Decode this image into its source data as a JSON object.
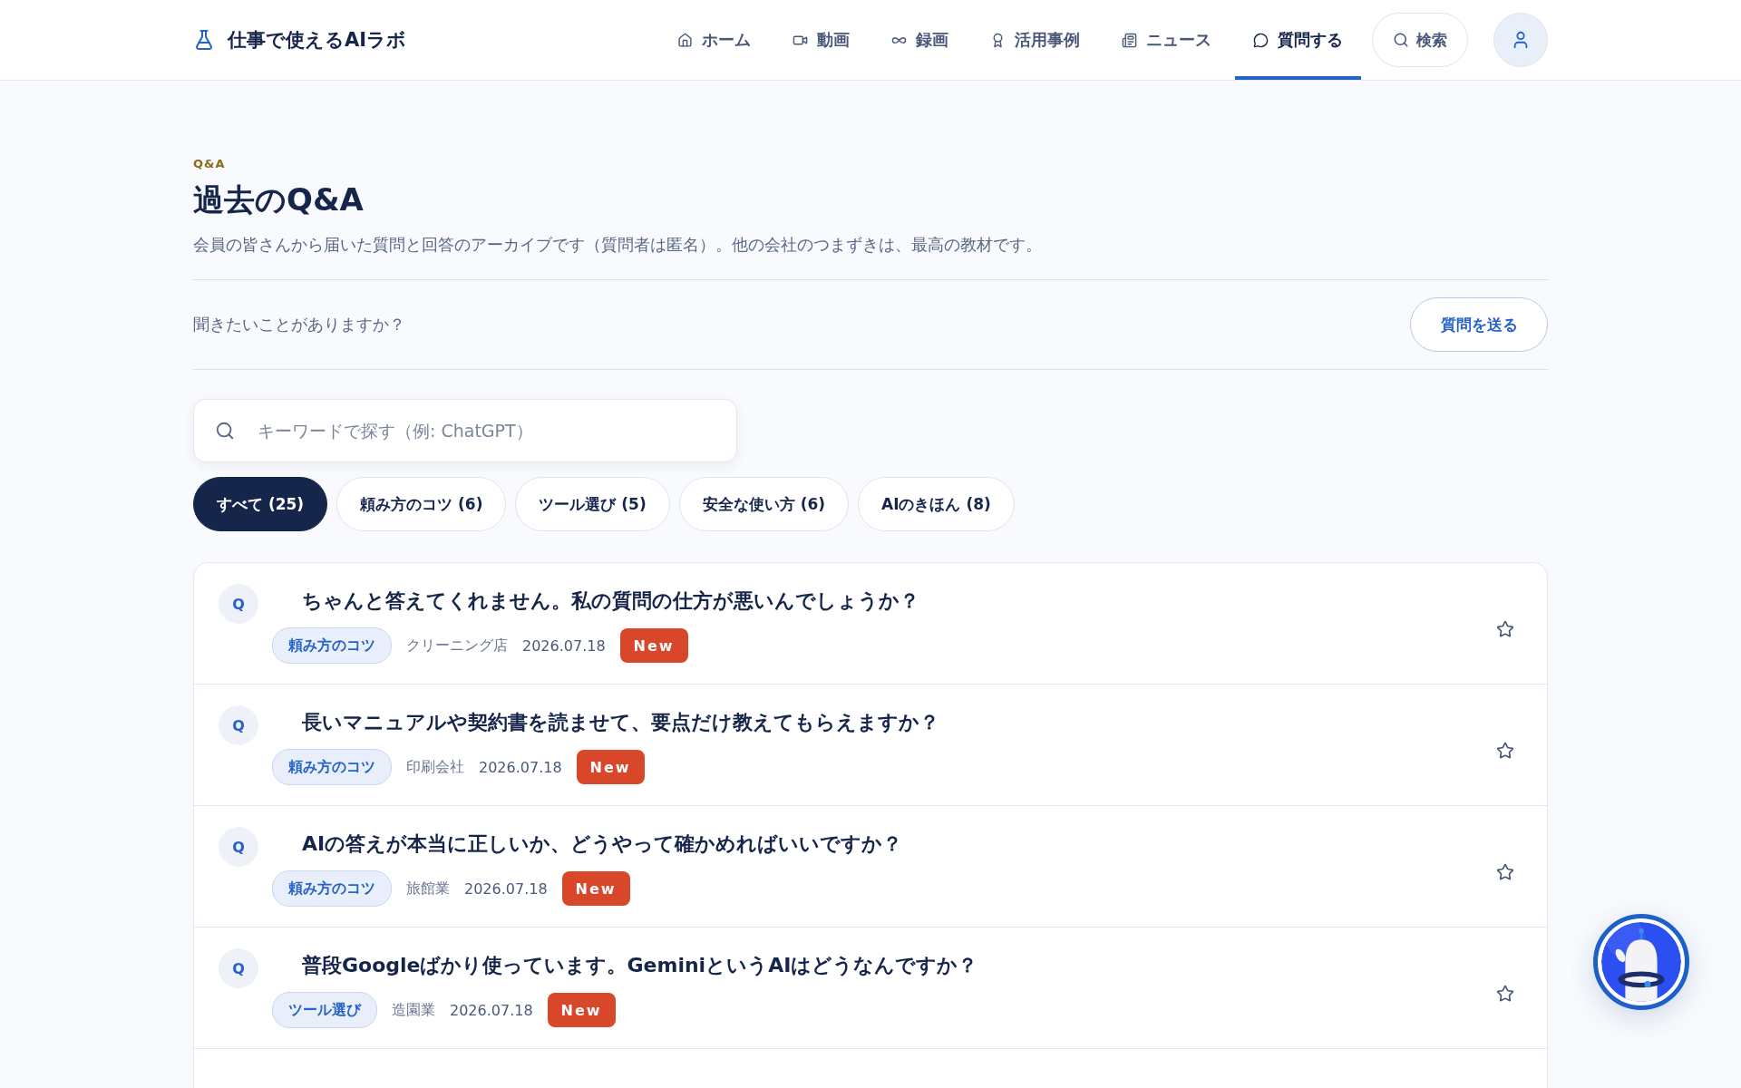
{
  "header": {
    "logo": "仕事で使えるAIラボ",
    "nav": [
      {
        "label": "ホーム",
        "selected": false
      },
      {
        "label": "動画",
        "selected": false
      },
      {
        "label": "録画",
        "selected": false
      },
      {
        "label": "活用事例",
        "selected": false
      },
      {
        "label": "ニュース",
        "selected": false
      },
      {
        "label": "質問する",
        "selected": true
      }
    ],
    "search_button": "検索"
  },
  "eyebrow": "Q&A",
  "title": "過去のQ&A",
  "description": "会員の皆さんから届いた質問と回答のアーカイブです（質問者は匿名）。他の会社のつまずきは、最高の教材です。",
  "ask": {
    "prompt": "聞きたいことがありますか？",
    "button": "質問を送る"
  },
  "search": {
    "placeholder": "キーワードで探す（例: ChatGPT）"
  },
  "filters": [
    {
      "label": "すべて (25)",
      "selected": true
    },
    {
      "label": "頼み方のコツ (6)",
      "selected": false
    },
    {
      "label": "ツール選び (5)",
      "selected": false
    },
    {
      "label": "安全な使い方 (6)",
      "selected": false
    },
    {
      "label": "AIのきほん (8)",
      "selected": false
    }
  ],
  "questions": [
    {
      "badge": "Q",
      "title": "ちゃんと答えてくれません。私の質問の仕方が悪いんでしょうか？",
      "tag": "頼み方のコツ",
      "industry": "クリーニング店",
      "date": "2026.07.18",
      "new": "New",
      "starred": false
    },
    {
      "badge": "Q",
      "title": "長いマニュアルや契約書を読ませて、要点だけ教えてもらえますか？",
      "tag": "頼み方のコツ",
      "industry": "印刷会社",
      "date": "2026.07.18",
      "new": "New",
      "starred": false
    },
    {
      "badge": "Q",
      "title": "AIの答えが本当に正しいか、どうやって確かめればいいですか？",
      "tag": "頼み方のコツ",
      "industry": "旅館業",
      "date": "2026.07.18",
      "new": "New",
      "starred": false
    },
    {
      "badge": "Q",
      "title": "普段Googleばかり使っています。GeminiというAIはどうなんですか？",
      "tag": "ツール選び",
      "industry": "造園業",
      "date": "2026.07.18",
      "new": "New",
      "starred": false
    }
  ]
}
